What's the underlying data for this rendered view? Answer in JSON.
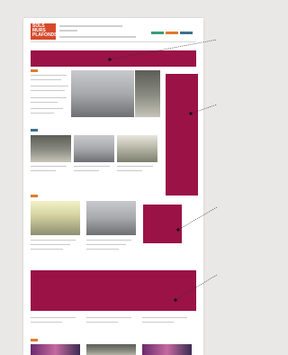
{
  "logo": {
    "line1": "SOLS",
    "line2": "MURS",
    "line3": "PLAFONDS"
  },
  "colors": {
    "magenta": "#9b1246",
    "orange": "#e07a2e",
    "green": "#3a9a7a",
    "blue": "#3d6f8e"
  },
  "sections": [
    {
      "tag": "orange",
      "kind": "hero"
    },
    {
      "tag": "blue",
      "kind": "grid-3"
    },
    {
      "tag": "orange",
      "kind": "grid-2"
    },
    {
      "tag": "orange",
      "kind": "strip"
    }
  ]
}
